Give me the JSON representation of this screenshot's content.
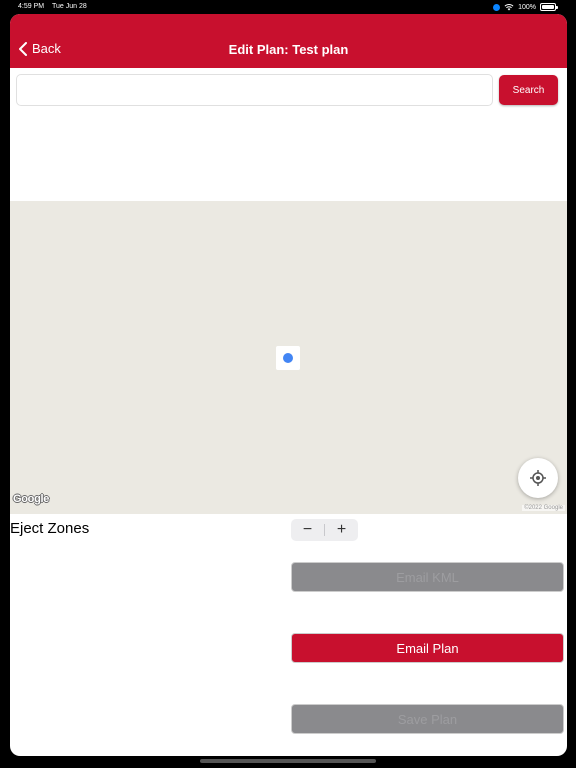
{
  "status_bar": {
    "time": "4:59 PM",
    "date": "Tue Jun 28",
    "battery": "100%",
    "battery_level": 1.0
  },
  "navbar": {
    "back_label": "Back",
    "title": "Edit Plan: Test plan",
    "color": "#c8102e"
  },
  "search": {
    "value": "",
    "placeholder": "",
    "button_label": "Search"
  },
  "map": {
    "logo": "Google",
    "copyright": "©2022 Google"
  },
  "eject_zones": {
    "title": "Eject Zones",
    "minus": "−",
    "plus": "+"
  },
  "buttons": {
    "email_kml": "Email KML",
    "email_plan": "Email Plan",
    "save_plan": "Save Plan"
  }
}
